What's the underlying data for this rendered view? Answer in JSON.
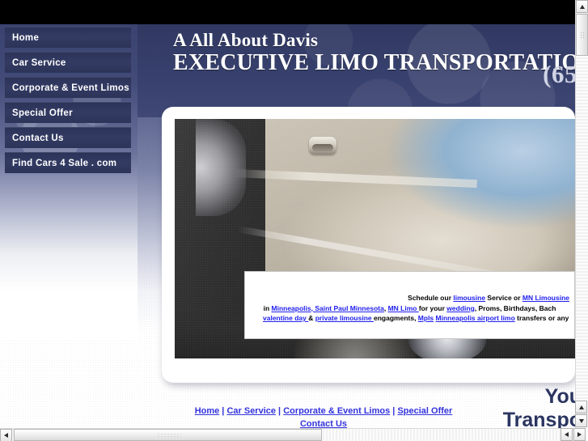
{
  "site": {
    "brand_line1": "A All About Davis",
    "brand_line2_word1": "E",
    "brand_line2": "EXECUTIVE LIMO TRANSPORTATION",
    "phone_visible": "(65",
    "tagline_line1": "You",
    "tagline_line2": "Transpo"
  },
  "sidebar": {
    "items": [
      {
        "label": "Home"
      },
      {
        "label": "Car Service"
      },
      {
        "label": "Corporate & Event Limos"
      },
      {
        "label": "Special Offer"
      },
      {
        "label": "Contact Us"
      },
      {
        "label": "Find Cars 4 Sale . com"
      }
    ]
  },
  "copy": {
    "line1": {
      "t1": "Schedule our ",
      "l1": "limousine",
      "t2": " Service or ",
      "l2": "MN Limousine "
    },
    "line2": {
      "t1": "in ",
      "l1": "Minneapolis, Saint Paul Minnesota",
      "t2": ", ",
      "l2": "MN Limo ",
      "t3": "for your ",
      "l3": "wedding",
      "t4": ", Proms, Birthdays, Bach"
    },
    "line3": {
      "l1": "valentine day ",
      "t1": " & ",
      "l2": "private limousine ",
      "t2": " engagments, ",
      "l3": "Mpls",
      "t3": " ",
      "l4": "Minneapolis airport limo",
      "t4": " transfers or any"
    }
  },
  "footer": {
    "links": [
      {
        "label": "Home"
      },
      {
        "label": "Car Service"
      },
      {
        "label": "Corporate & Event Limos"
      },
      {
        "label": "Special Offer"
      }
    ],
    "separator": " | ",
    "last_link": "Contact Us"
  },
  "colors": {
    "navy": "#2e3660",
    "nav_button": "#2b3359",
    "link_blue": "#3333dd",
    "overlay_link": "#2020ee",
    "tagline": "#2b3560"
  },
  "browser": {
    "v_scroll_up": "scroll-up",
    "v_scroll_down": "scroll-down",
    "h_scroll_left": "scroll-left",
    "h_scroll_right": "scroll-right"
  }
}
